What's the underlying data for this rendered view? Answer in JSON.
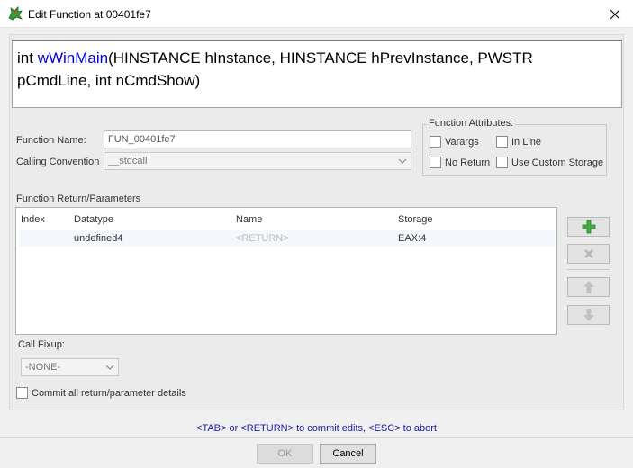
{
  "window": {
    "title": "Edit Function at 00401fe7",
    "close_icon": "close-icon",
    "app_icon": "dragon-icon"
  },
  "signature": {
    "prefix": "int ",
    "function_name": "wWinMain",
    "params_line1": "(HINSTANCE hInstance, HINSTANCE hPrevInstance, PWSTR",
    "params_line2": "pCmdLine, int nCmdShow)",
    "name_color": "#0000dd"
  },
  "form": {
    "function_name_label": "Function Name:",
    "function_name_value": "FUN_00401fe7",
    "calling_convention_label": "Calling Convention",
    "calling_convention_value": "__stdcall"
  },
  "attributes": {
    "title": "Function Attributes:",
    "varargs": "Varargs",
    "in_line": "In Line",
    "no_return": "No Return",
    "use_custom_storage": "Use Custom Storage"
  },
  "params": {
    "section_label": "Function Return/Parameters",
    "columns": [
      "Index",
      "Datatype",
      "Name",
      "Storage"
    ],
    "rows": [
      {
        "index": "",
        "datatype": "undefined4",
        "name": "<RETURN>",
        "storage": "EAX:4"
      }
    ]
  },
  "side_buttons": {
    "add": "plus-icon",
    "remove": "x-icon",
    "up": "arrow-up-icon",
    "down": "arrow-down-icon"
  },
  "fixup": {
    "label": "Call Fixup:",
    "value": "-NONE-"
  },
  "commit_label": "Commit all return/parameter details",
  "hint": "<TAB> or <RETURN> to commit edits, <ESC> to abort",
  "buttons": {
    "ok": "OK",
    "cancel": "Cancel"
  },
  "colors": {
    "add_green": "#3fae3f",
    "hint_blue": "#1a1aa6"
  }
}
